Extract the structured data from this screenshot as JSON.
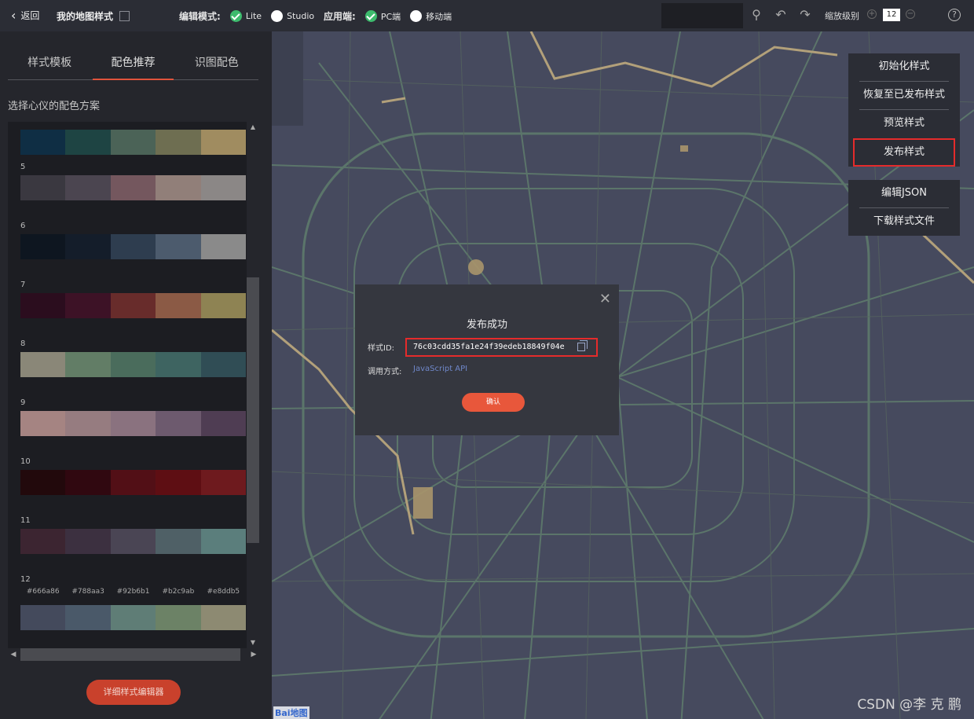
{
  "topbar": {
    "back_label": "返回",
    "title": "我的地图样式",
    "edit_mode_label": "编辑模式:",
    "edit_modes": [
      "Lite",
      "Studio"
    ],
    "app_label": "应用端:",
    "app_options": [
      "PC端",
      "移动端"
    ],
    "zoom_label": "缩放级别",
    "zoom_value": "12"
  },
  "left": {
    "tabs": [
      "样式模板",
      "配色推荐",
      "识图配色"
    ],
    "scheme_title": "选择心仪的配色方案",
    "schemes": [
      {
        "num": "",
        "colors": [
          "#0f2e44",
          "#1e4443",
          "#4b6357",
          "#6e6e51",
          "#a08c60"
        ]
      },
      {
        "num": "5",
        "colors": [
          "#3a3840",
          "#4b4550",
          "#74575e",
          "#917f79",
          "#8b8786"
        ]
      },
      {
        "num": "6",
        "colors": [
          "#0e1620",
          "#141d2a",
          "#2e3d4f",
          "#4c5b6d",
          "#8a8a8a"
        ]
      },
      {
        "num": "7",
        "colors": [
          "#2b0d1e",
          "#3d1226",
          "#682c2b",
          "#8b5a45",
          "#8e8353"
        ]
      },
      {
        "num": "8",
        "colors": [
          "#8a8778",
          "#627d66",
          "#4a6c5c",
          "#3e6461",
          "#304d55"
        ]
      },
      {
        "num": "9",
        "colors": [
          "#a58482",
          "#967c80",
          "#8a727f",
          "#6d5a6e",
          "#4f3d53"
        ]
      },
      {
        "num": "10",
        "colors": [
          "#22090c",
          "#300810",
          "#520f16",
          "#5e0e13",
          "#6e1a1e"
        ]
      },
      {
        "num": "11",
        "colors": [
          "#3c2531",
          "#3c3040",
          "#4a4554",
          "#4f6066",
          "#5b7e7c"
        ]
      },
      {
        "num": "12",
        "colors": [
          "#444a5c",
          "#4a5969",
          "#5f7d76",
          "#6c8266",
          "#8d8a72"
        ],
        "hexes": [
          "#666a86",
          "#788aa3",
          "#92b6b1",
          "#b2c9ab",
          "#e8ddb5"
        ]
      }
    ],
    "detail_button": "详细样式编辑器"
  },
  "menu": {
    "group1": [
      "初始化样式",
      "恢复至已发布样式",
      "预览样式",
      "发布样式"
    ],
    "group2": [
      "编辑JSON",
      "下载样式文件"
    ]
  },
  "modal": {
    "title": "发布成功",
    "id_label": "样式ID:",
    "style_id": "76c03cdd35fa1e24f39edeb18849f04e",
    "call_label": "调用方式:",
    "call_value": "JavaScript API",
    "ok_label": "确认"
  },
  "map": {
    "logo": "Bai地图",
    "watermark": "CSDN @李 克 鹏"
  }
}
